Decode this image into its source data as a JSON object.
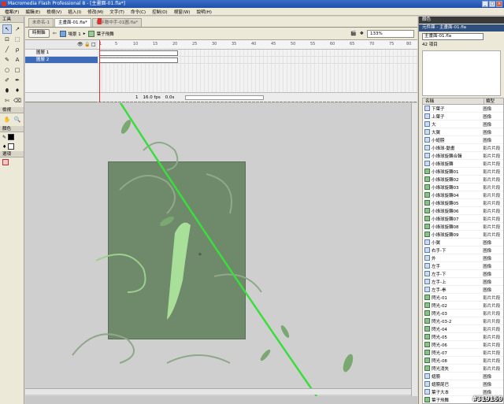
{
  "window": {
    "title": "Macromedia Flash Professional 8 - [主畫面-01.fla*]",
    "buttons": [
      "_",
      "□",
      "×"
    ]
  },
  "menu": [
    "檔案(F)",
    "編輯(E)",
    "檢視(V)",
    "插入(I)",
    "修改(M)",
    "文字(T)",
    "命令(C)",
    "控制(O)",
    "視窗(W)",
    "說明(H)"
  ],
  "toolbox": {
    "title": "工具",
    "tools": [
      "↖",
      "↗",
      "⊡",
      "⬚",
      "╱",
      "ρ",
      "✎",
      "A",
      "○",
      "□",
      "✐",
      "✒",
      "⬮",
      "♦",
      "✄",
      "⌫"
    ],
    "view_title": "檢視",
    "view_tools": [
      "✋",
      "🔍"
    ],
    "color_title": "顏色",
    "options_title": "選項",
    "colors": {
      "stroke": "#000000",
      "fill": "#ffffff"
    }
  },
  "tabs": [
    "未命名-1",
    "主畫面-01.fla*",
    "長年敵中手-01圖.fla*"
  ],
  "doc_toolbar": {
    "timeline_button": "時間軸",
    "scene": "場景 1",
    "symbol": "葉子飛舞",
    "zoom": "133%"
  },
  "timeline": {
    "layers": [
      "圖層 1",
      "圖層 2"
    ],
    "ruler": [
      "1",
      "5",
      "10",
      "15",
      "20",
      "25",
      "30",
      "35",
      "40",
      "45",
      "50",
      "55",
      "60",
      "65",
      "70",
      "75",
      "80"
    ],
    "footer": {
      "frame": "1",
      "fps": "16.0 fps",
      "time": "0.0s"
    }
  },
  "right_panel": {
    "color_panel_title": "顏色",
    "library_title": "元件庫 - 主畫面-01.fla",
    "library_select": "主畫面-01.fla",
    "item_count": "42 項目",
    "columns": {
      "name": "名稱",
      "type": "類型"
    },
    "items": [
      {
        "name": "下葉子",
        "type": "圖像",
        "kind": "graphic"
      },
      {
        "name": "上葉子",
        "type": "圖像",
        "kind": "graphic"
      },
      {
        "name": "大",
        "type": "圖像",
        "kind": "graphic"
      },
      {
        "name": "大翼",
        "type": "圖像",
        "kind": "graphic"
      },
      {
        "name": "小翅膀",
        "type": "圖像",
        "kind": "graphic"
      },
      {
        "name": "小綠球-動畫",
        "type": "影片片段",
        "kind": "graphic"
      },
      {
        "name": "小綠球旋轉合輯",
        "type": "影片片段",
        "kind": "graphic"
      },
      {
        "name": "小綠球旋轉",
        "type": "影片片段",
        "kind": "graphic"
      },
      {
        "name": "小綠球旋轉01",
        "type": "影片片段",
        "kind": "button"
      },
      {
        "name": "小綠球旋轉02",
        "type": "影片片段",
        "kind": "button"
      },
      {
        "name": "小綠球旋轉03",
        "type": "影片片段",
        "kind": "button"
      },
      {
        "name": "小綠球旋轉04",
        "type": "影片片段",
        "kind": "button"
      },
      {
        "name": "小綠球旋轉05",
        "type": "影片片段",
        "kind": "button"
      },
      {
        "name": "小綠球旋轉06",
        "type": "影片片段",
        "kind": "button"
      },
      {
        "name": "小綠球旋轉07",
        "type": "影片片段",
        "kind": "button"
      },
      {
        "name": "小綠球旋轉08",
        "type": "影片片段",
        "kind": "button"
      },
      {
        "name": "小綠球旋轉09",
        "type": "影片片段",
        "kind": "button"
      },
      {
        "name": "小翼",
        "type": "圖像",
        "kind": "graphic"
      },
      {
        "name": "右手-下",
        "type": "圖像",
        "kind": "graphic"
      },
      {
        "name": "外",
        "type": "圖像",
        "kind": "graphic"
      },
      {
        "name": "左手",
        "type": "圖像",
        "kind": "graphic"
      },
      {
        "name": "左手-下",
        "type": "圖像",
        "kind": "graphic"
      },
      {
        "name": "左手-上",
        "type": "圖像",
        "kind": "graphic"
      },
      {
        "name": "左手-拳",
        "type": "圖像",
        "kind": "graphic"
      },
      {
        "name": "閃光-01",
        "type": "影片片段",
        "kind": "button"
      },
      {
        "name": "閃光-02",
        "type": "影片片段",
        "kind": "button"
      },
      {
        "name": "閃光-03",
        "type": "影片片段",
        "kind": "button"
      },
      {
        "name": "閃光-03-2",
        "type": "影片片段",
        "kind": "button"
      },
      {
        "name": "閃光-04",
        "type": "影片片段",
        "kind": "button"
      },
      {
        "name": "閃光-05",
        "type": "影片片段",
        "kind": "button"
      },
      {
        "name": "閃光-06",
        "type": "影片片段",
        "kind": "button"
      },
      {
        "name": "閃光-07",
        "type": "影片片段",
        "kind": "button"
      },
      {
        "name": "閃光-08",
        "type": "影片片段",
        "kind": "button"
      },
      {
        "name": "閃光消失",
        "type": "影片片段",
        "kind": "button"
      },
      {
        "name": "翅膀",
        "type": "圖像",
        "kind": "graphic"
      },
      {
        "name": "翅膀尾巴",
        "type": "圖像",
        "kind": "graphic"
      },
      {
        "name": "葉子大本",
        "type": "圖像",
        "kind": "graphic"
      },
      {
        "name": "葉子飛舞",
        "type": "影片片段",
        "kind": "button"
      }
    ]
  },
  "watermark": "#319160"
}
